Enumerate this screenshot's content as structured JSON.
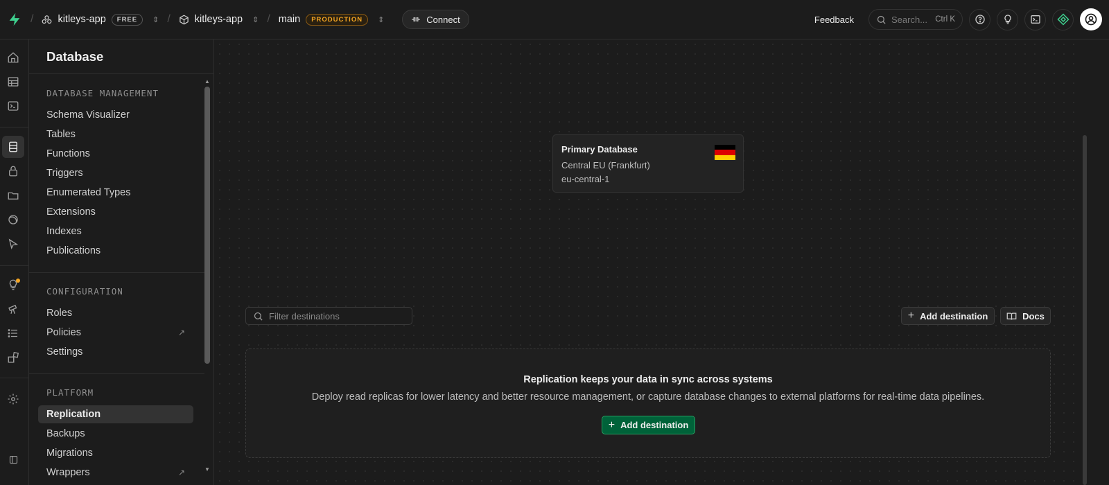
{
  "topbar": {
    "org_name": "kitleys-app",
    "org_badge": "FREE",
    "project_name": "kitleys-app",
    "branch_name": "main",
    "branch_badge": "PRODUCTION",
    "connect_label": "Connect",
    "feedback_label": "Feedback",
    "search_placeholder": "Search...",
    "search_shortcut": "Ctrl K"
  },
  "rail": {
    "icons": [
      "home-icon",
      "table-editor-icon",
      "sql-editor-icon",
      "database-icon",
      "auth-icon",
      "storage-icon",
      "realtime-icon",
      "edge-functions-icon",
      "advisors-icon",
      "reports-icon",
      "logs-icon",
      "integrations-icon",
      "settings-icon",
      "collapse-sidebar-icon"
    ],
    "active": "database-icon"
  },
  "sidebar": {
    "title": "Database",
    "sections": [
      {
        "heading": "DATABASE MANAGEMENT",
        "items": [
          "Schema Visualizer",
          "Tables",
          "Functions",
          "Triggers",
          "Enumerated Types",
          "Extensions",
          "Indexes",
          "Publications"
        ]
      },
      {
        "heading": "CONFIGURATION",
        "items": [
          "Roles",
          "Policies",
          "Settings"
        ]
      },
      {
        "heading": "PLATFORM",
        "items": [
          "Replication",
          "Backups",
          "Migrations",
          "Wrappers"
        ]
      }
    ],
    "active_item": "Replication"
  },
  "main": {
    "primary_db": {
      "title": "Primary Database",
      "region": "Central EU (Frankfurt)",
      "region_code": "eu-central-1",
      "flag_colors": [
        "#000000",
        "#dd0000",
        "#ffce00"
      ]
    },
    "filter_placeholder": "Filter destinations",
    "add_destination_label": "Add destination",
    "docs_label": "Docs",
    "empty": {
      "heading": "Replication keeps your data in sync across systems",
      "description": "Deploy read replicas for lower latency and better resource management, or capture database changes to external platforms for real-time data pipelines.",
      "button_label": "Add destination"
    }
  },
  "colors": {
    "brand": "#3ecf8e",
    "accent_green": "#006239",
    "production": "#f5a623",
    "notification_dot": "#f5a623"
  }
}
